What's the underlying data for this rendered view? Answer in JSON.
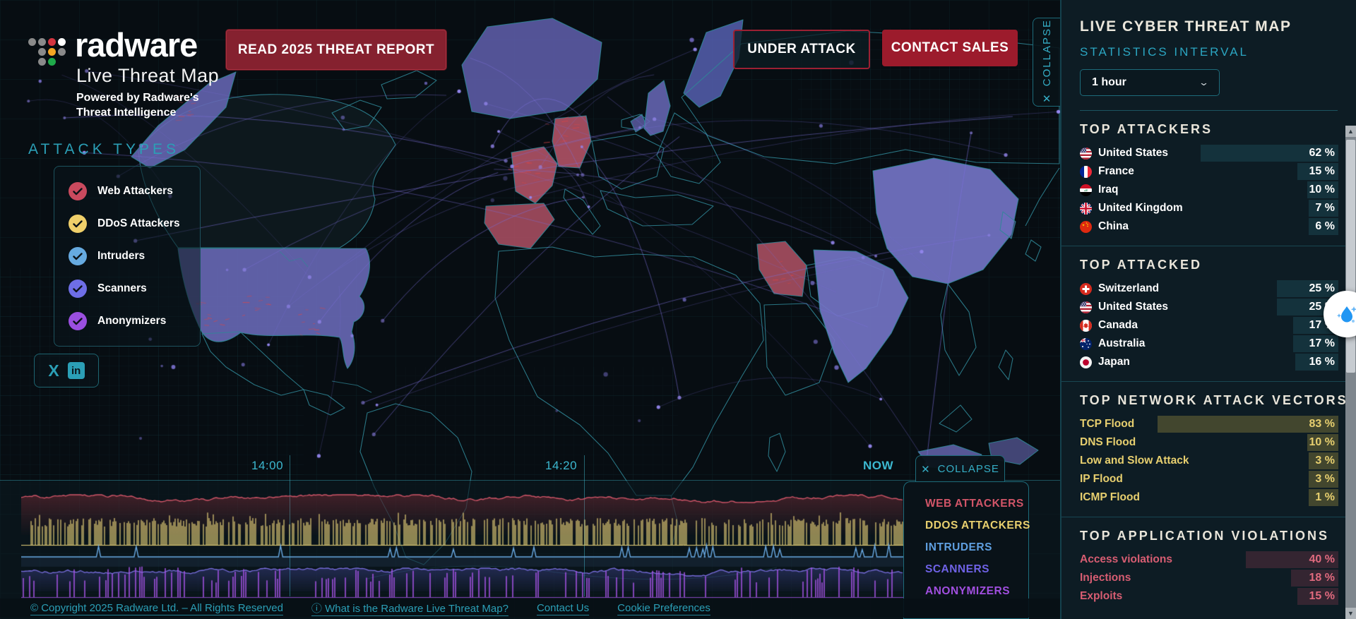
{
  "brand": {
    "wordmark": "radware",
    "subtitle": "Live Threat Map",
    "tagline": "Powered by Radware's Threat Intelligence"
  },
  "header_buttons": {
    "report": "READ 2025 THREAT REPORT",
    "under_attack": "UNDER ATTACK",
    "contact_sales": "CONTACT SALES"
  },
  "map_collapse_label": "COLLAPSE",
  "attack_types": {
    "title": "ATTACK TYPES",
    "items": [
      {
        "label": "Web Attackers",
        "color": "#c94a5e"
      },
      {
        "label": "DDoS Attackers",
        "color": "#f0d06a"
      },
      {
        "label": "Intruders",
        "color": "#66aae0"
      },
      {
        "label": "Scanners",
        "color": "#6e6ee6"
      },
      {
        "label": "Anonymizers",
        "color": "#9b4fe0"
      }
    ]
  },
  "social": {
    "x_label": "X",
    "linkedin_label": "in"
  },
  "timeline": {
    "time_labels": [
      "14:00",
      "14:20",
      "NOW"
    ],
    "collapse_label": "COLLAPSE",
    "legend": [
      {
        "label": "WEB ATTACKERS",
        "color": "#d15568"
      },
      {
        "label": "DDOS ATTACKERS",
        "color": "#e8cf6e"
      },
      {
        "label": "INTRUDERS",
        "color": "#5f9fe0"
      },
      {
        "label": "SCANNERS",
        "color": "#6f62e6"
      },
      {
        "label": "ANONYMIZERS",
        "color": "#a14fe0"
      }
    ]
  },
  "side_panel": {
    "title": "LIVE CYBER THREAT MAP",
    "interval_label": "STATISTICS INTERVAL",
    "interval_value": "1 hour",
    "sections": [
      {
        "id": "top-attackers",
        "title": "TOP ATTACKERS",
        "style": "teal",
        "rows": [
          {
            "flag": "us",
            "label": "United States",
            "pct": 62
          },
          {
            "flag": "fr",
            "label": "France",
            "pct": 15
          },
          {
            "flag": "iq",
            "label": "Iraq",
            "pct": 10
          },
          {
            "flag": "gb",
            "label": "United Kingdom",
            "pct": 7
          },
          {
            "flag": "cn",
            "label": "China",
            "pct": 6
          }
        ]
      },
      {
        "id": "top-attacked",
        "title": "TOP ATTACKED",
        "style": "teal",
        "rows": [
          {
            "flag": "ch",
            "label": "Switzerland",
            "pct": 25
          },
          {
            "flag": "us",
            "label": "United States",
            "pct": 25
          },
          {
            "flag": "ca",
            "label": "Canada",
            "pct": 17
          },
          {
            "flag": "au",
            "label": "Australia",
            "pct": 17
          },
          {
            "flag": "jp",
            "label": "Japan",
            "pct": 16
          }
        ]
      },
      {
        "id": "top-network-attack-vectors",
        "title": "TOP NETWORK ATTACK VECTORS",
        "style": "yellow",
        "rows": [
          {
            "label": "TCP Flood",
            "pct": 83
          },
          {
            "label": "DNS Flood",
            "pct": 10
          },
          {
            "label": "Low and Slow Attack",
            "pct": 3
          },
          {
            "label": "IP Flood",
            "pct": 3
          },
          {
            "label": "ICMP Flood",
            "pct": 1
          }
        ]
      },
      {
        "id": "top-application-violations",
        "title": "TOP APPLICATION VIOLATIONS",
        "style": "red",
        "rows": [
          {
            "label": "Access violations",
            "pct": 40
          },
          {
            "label": "Injections",
            "pct": 18
          },
          {
            "label": "Exploits",
            "pct": 15
          }
        ]
      }
    ]
  },
  "footer": {
    "links": [
      {
        "label": "© Copyright 2025 Radware Ltd. – All Rights Reserved"
      },
      {
        "label": "ⓘ What is the Radware Live Threat Map?"
      },
      {
        "label": "Contact Us"
      },
      {
        "label": "Cookie Preferences"
      }
    ]
  },
  "colors": {
    "accent_teal": "#2b9fb6",
    "crimson": "#9c1b2c",
    "bar_teal": "rgba(52,140,160,0.20)",
    "bar_yellow": "rgba(190,170,70,0.30)",
    "bar_red": "rgba(190,75,95,0.22)",
    "text_yellow": "#e7cf6f",
    "text_red": "#d75d72"
  }
}
